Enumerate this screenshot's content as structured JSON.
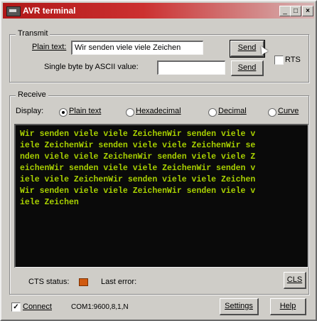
{
  "window": {
    "title": "AVR terminal",
    "controls": [
      "_",
      "□",
      "×"
    ]
  },
  "transmit": {
    "group_label": "Transmit",
    "plain_text_label": "Plain text:",
    "plain_text_value": "Wir senden viele viele Zeichen",
    "send_plain_label": "Send",
    "single_byte_label": "Single byte by ASCII value:",
    "single_byte_value": "",
    "send_byte_label": "Send",
    "rts_label": "RTS",
    "rts_checked": false
  },
  "receive": {
    "group_label": "Receive",
    "display_label": "Display:",
    "display_options": [
      {
        "label": "Plain text",
        "selected": true
      },
      {
        "label": "Hexadecimal",
        "selected": false
      },
      {
        "label": "Decimal",
        "selected": false
      },
      {
        "label": "Curve",
        "selected": false
      }
    ],
    "terminal_lines": [
      "Wir senden viele viele ZeichenWir senden viele v",
      "iele ZeichenWir senden viele viele ZeichenWir se",
      "nden viele viele ZeichenWir senden viele viele Z",
      "eichenWir senden viele viele ZeichenWir senden v",
      "iele viele ZeichenWir senden viele viele Zeichen",
      "Wir senden viele viele ZeichenWir senden viele v",
      "iele Zeichen"
    ],
    "terminal_text_color": "#a8d000",
    "terminal_bg_color": "#0a0a0a",
    "cts_status_label": "CTS status:",
    "cts_led_color": "#d05a10",
    "last_error_label": "Last error:",
    "last_error_value": "",
    "cls_label": "CLS"
  },
  "footer": {
    "connect_label": "Connect",
    "connect_checked": true,
    "connection_info": "COM1:9600,8,1,N",
    "settings_label": "Settings",
    "help_label": "Help"
  },
  "colors": {
    "titlebar_accent": "#b01818",
    "window_bg": "#cfcdc8"
  }
}
